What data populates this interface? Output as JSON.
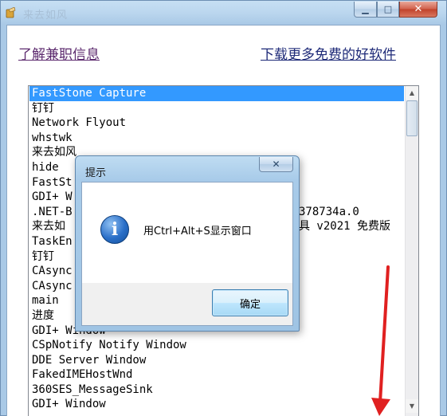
{
  "window": {
    "title": "来去如风"
  },
  "links": {
    "left": "了解兼职信息",
    "right": "下载更多免费的好软件"
  },
  "list": {
    "items": [
      "FastStone Capture",
      "钉钉",
      "Network Flyout",
      "whstwk",
      "来去如风",
      "hide",
      "FastSt",
      "GDI+ W",
      ".NET-B",
      "来去如",
      "TaskEn",
      "钉钉",
      "CAsync",
      "CAsync",
      "main",
      "进度",
      "GDI+ Window",
      "CSpNotify Notify Window",
      "DDE Server Window",
      "FakedIMEHostWnd",
      "360SES_MessageSink",
      "GDI+ Window"
    ],
    "selected_index": 0,
    "partial_right_texts": {
      "row8": "378734a.0",
      "row9": "具 v2021 免费版"
    }
  },
  "dialog": {
    "title": "提示",
    "message": "用Ctrl+Alt+S显示窗口",
    "ok_label": "确定"
  },
  "icons": {
    "app": "feather-app-icon",
    "info": "info-icon",
    "close": "close-icon"
  },
  "colors": {
    "selection": "#3399ff",
    "annotation_arrow": "#e02020"
  }
}
